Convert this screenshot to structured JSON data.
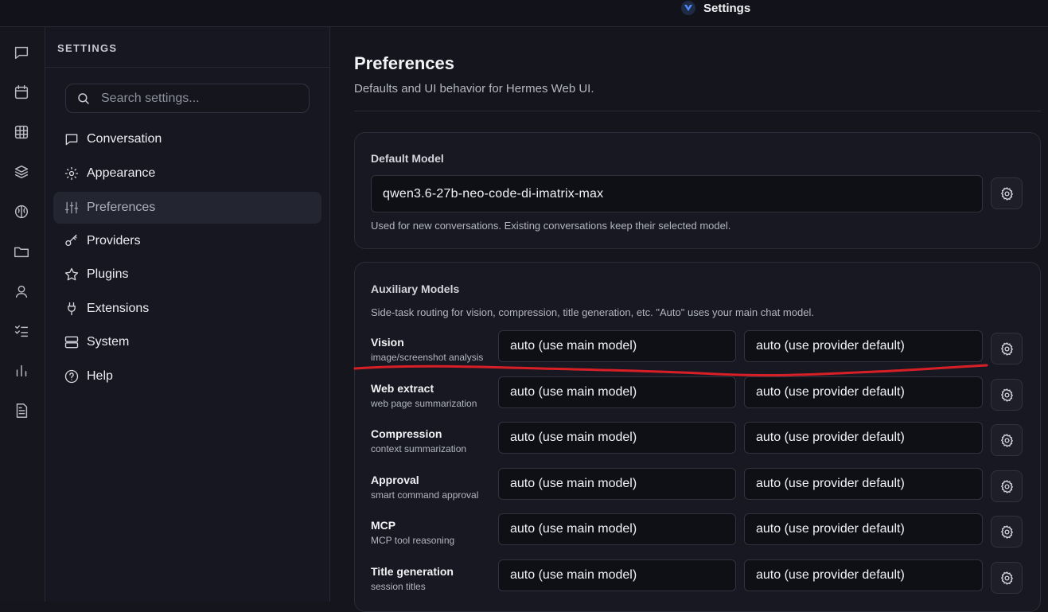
{
  "topbar": {
    "title": "Settings"
  },
  "rail": {
    "icons": [
      "chat-icon",
      "calendar-icon",
      "grid-icon",
      "layers-icon",
      "brain-icon",
      "folder-icon",
      "user-icon",
      "checklist-icon",
      "bar-chart-icon",
      "document-icon"
    ]
  },
  "sidebar": {
    "header": "SETTINGS",
    "search_placeholder": "Search settings...",
    "items": [
      {
        "label": "Conversation",
        "icon": "chat-bubble-icon",
        "active": false
      },
      {
        "label": "Appearance",
        "icon": "sun-icon",
        "active": false
      },
      {
        "label": "Preferences",
        "icon": "sliders-icon",
        "active": true
      },
      {
        "label": "Providers",
        "icon": "key-icon",
        "active": false
      },
      {
        "label": "Plugins",
        "icon": "star-icon",
        "active": false
      },
      {
        "label": "Extensions",
        "icon": "plug-icon",
        "active": false
      },
      {
        "label": "System",
        "icon": "server-icon",
        "active": false
      },
      {
        "label": "Help",
        "icon": "help-icon",
        "active": false
      }
    ]
  },
  "main": {
    "title": "Preferences",
    "subtitle": "Defaults and UI behavior for Hermes Web UI.",
    "default_model": {
      "label": "Default Model",
      "value": "qwen3.6-27b-neo-code-di-imatrix-max",
      "hint": "Used for new conversations. Existing conversations keep their selected model."
    },
    "auxiliary": {
      "label": "Auxiliary Models",
      "hint": "Side-task routing for vision, compression, title generation, etc. \"Auto\" uses your main chat model.",
      "rows": [
        {
          "name": "Vision",
          "desc": "image/screenshot analysis",
          "model": "auto (use main model)",
          "provider": "auto (use provider default)"
        },
        {
          "name": "Web extract",
          "desc": "web page summarization",
          "model": "auto (use main model)",
          "provider": "auto (use provider default)"
        },
        {
          "name": "Compression",
          "desc": "context summarization",
          "model": "auto (use main model)",
          "provider": "auto (use provider default)"
        },
        {
          "name": "Approval",
          "desc": "smart command approval",
          "model": "auto (use main model)",
          "provider": "auto (use provider default)"
        },
        {
          "name": "MCP",
          "desc": "MCP tool reasoning",
          "model": "auto (use main model)",
          "provider": "auto (use provider default)"
        },
        {
          "name": "Title generation",
          "desc": "session titles",
          "model": "auto (use main model)",
          "provider": "auto (use provider default)"
        }
      ]
    }
  },
  "colors": {
    "annotation": "#d81f26",
    "accent_logo": "#4f8cff"
  }
}
